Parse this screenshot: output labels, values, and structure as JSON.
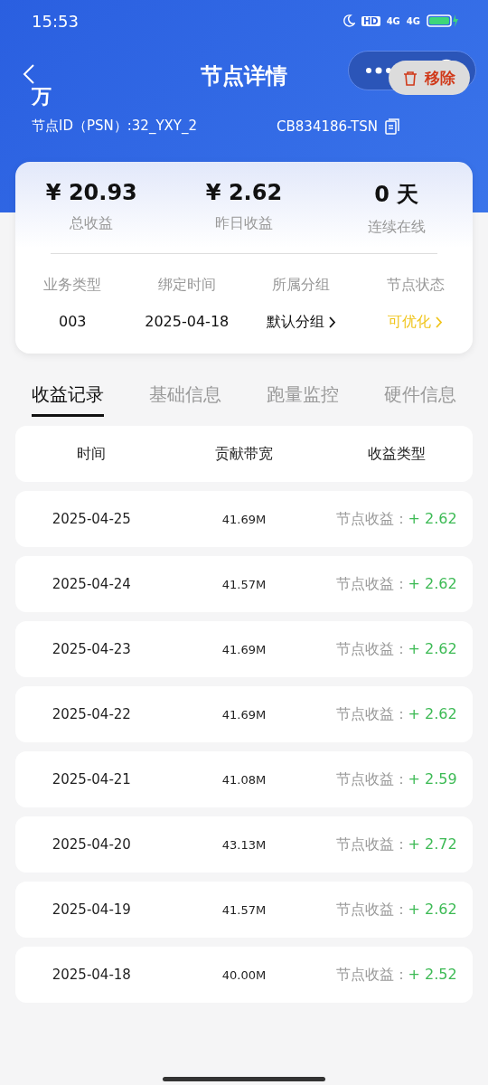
{
  "status_bar": {
    "time": "15:53",
    "hd_label": "HD",
    "net_labels": [
      "4G",
      "4G"
    ]
  },
  "header": {
    "title": "节点详情",
    "node_name": "万",
    "node_id_prefix": "节点ID（PSN）:32_YXY_2",
    "node_id_suffix": "CB834186-TSN"
  },
  "popup": {
    "label": "移除"
  },
  "stats": [
    {
      "value": "¥ 20.93",
      "label": "总收益"
    },
    {
      "value": "¥ 2.62",
      "label": "昨日收益"
    },
    {
      "value": "0 天",
      "label": "连续在线"
    }
  ],
  "info": [
    {
      "label": "业务类型",
      "value": "003",
      "kind": "plain"
    },
    {
      "label": "绑定时间",
      "value": "2025-04-18",
      "kind": "plain"
    },
    {
      "label": "所属分组",
      "value": "默认分组",
      "kind": "link"
    },
    {
      "label": "节点状态",
      "value": "可优化",
      "kind": "status"
    }
  ],
  "tabs": [
    {
      "label": "收益记录",
      "selected": true
    },
    {
      "label": "基础信息",
      "selected": false
    },
    {
      "label": "跑量监控",
      "selected": false
    },
    {
      "label": "硬件信息",
      "selected": false
    }
  ],
  "table": {
    "columns": [
      "时间",
      "贡献带宽",
      "收益类型"
    ],
    "rows": [
      {
        "date": "2025-04-25",
        "bandwidth": "41.69M",
        "type": "节点收益：",
        "amount": "+ 2.62"
      },
      {
        "date": "2025-04-24",
        "bandwidth": "41.57M",
        "type": "节点收益：",
        "amount": "+ 2.62"
      },
      {
        "date": "2025-04-23",
        "bandwidth": "41.69M",
        "type": "节点收益：",
        "amount": "+ 2.62"
      },
      {
        "date": "2025-04-22",
        "bandwidth": "41.69M",
        "type": "节点收益：",
        "amount": "+ 2.62"
      },
      {
        "date": "2025-04-21",
        "bandwidth": "41.08M",
        "type": "节点收益：",
        "amount": "+ 2.59"
      },
      {
        "date": "2025-04-20",
        "bandwidth": "43.13M",
        "type": "节点收益：",
        "amount": "+ 2.72"
      },
      {
        "date": "2025-04-19",
        "bandwidth": "41.57M",
        "type": "节点收益：",
        "amount": "+ 2.62"
      },
      {
        "date": "2025-04-18",
        "bandwidth": "40.00M",
        "type": "节点收益：",
        "amount": "+ 2.52"
      }
    ]
  }
}
